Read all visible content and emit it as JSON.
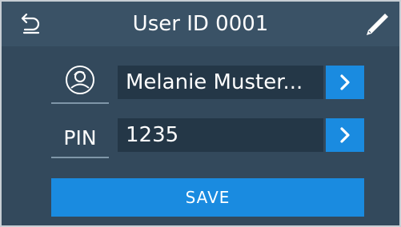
{
  "header": {
    "title": "User ID 0001",
    "back_icon": "undo-arrow-icon",
    "edit_icon": "pencil-icon"
  },
  "form": {
    "name_field": {
      "icon": "user-avatar-icon",
      "value": "Melanie Muster..."
    },
    "pin_field": {
      "label": "PIN",
      "value": "1235"
    },
    "arrow_icon": "chevron-right-icon"
  },
  "actions": {
    "save_label": "SAVE"
  },
  "colors": {
    "background": "#33495c",
    "field": "#243747",
    "accent": "#1a8be0"
  }
}
